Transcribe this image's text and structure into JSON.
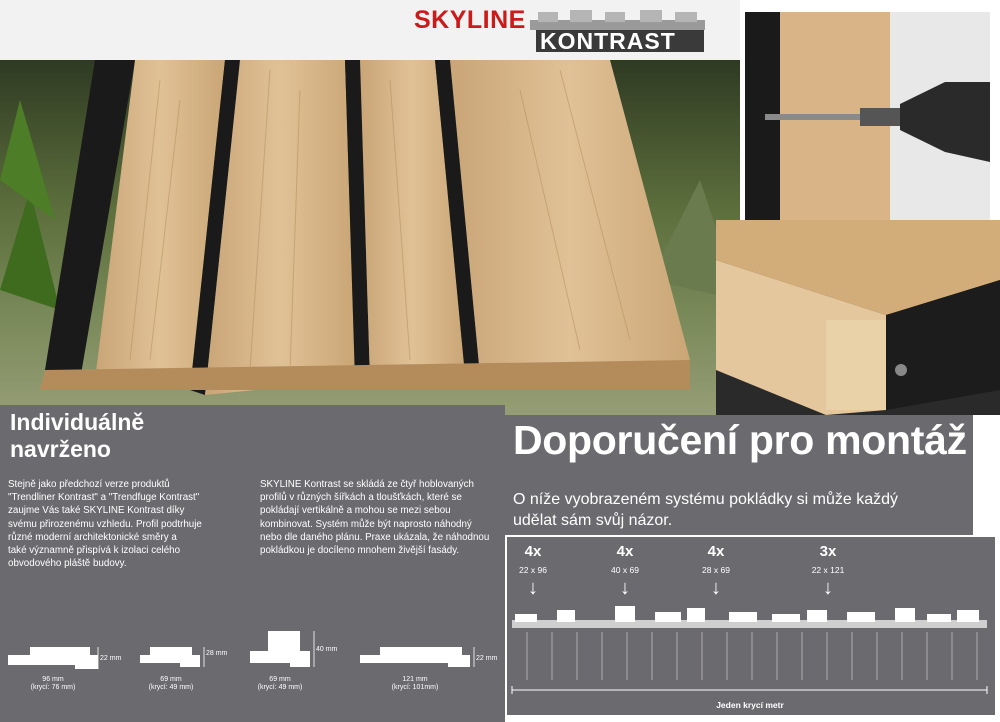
{
  "logo": {
    "brand": "SKYLINE",
    "product": "KONTRAST"
  },
  "left": {
    "title_line1": "Individuálně",
    "title_line2": "navrženo",
    "col1_lines": [
      "Stejně jako předchozí verze produktů",
      "\"Trendliner Kontrast\" a \"Trendfuge Kontrast\"",
      "zaujme Vás také SKYLINE Kontrast díky",
      "svému přirozenému vzhledu. Profil podtrhuje",
      "různé moderní architektonické směry a",
      "také významně přispívá k izolaci celého",
      "obvodového pláště budovy."
    ],
    "col2_lines": [
      "SKYLINE Kontrast se skládá ze čtyř hoblovaných",
      "profilů v různých šířkách a tloušťkách, které se",
      "pokládají vertikálně a mohou se mezi sebou",
      "kombinovat. Systém může být naprosto náhodný",
      "nebo dle daného plánu. Praxe ukázala, že náhodnou",
      "pokládkou je docíleno mnohem živější fasády."
    ],
    "profiles": [
      {
        "height": "22 mm",
        "width": "96 mm",
        "cover": "(krycí: 76 mm)"
      },
      {
        "height": "28 mm",
        "width": "69 mm",
        "cover": "(krycí: 49 mm)"
      },
      {
        "height": "40 mm",
        "width": "69 mm",
        "cover": "(krycí: 49 mm)"
      },
      {
        "height": "22 mm",
        "width": "121 mm",
        "cover": "(krycí: 101mm)"
      }
    ]
  },
  "right": {
    "title": "Doporučení pro montáž",
    "subtitle_line1": "O níže vyobrazeném systému pokládky si může každý",
    "subtitle_line2": "udělat sám svůj názor.",
    "items": [
      {
        "qty": "4x",
        "dims": "22 x 96"
      },
      {
        "qty": "4x",
        "dims": "40 x 69"
      },
      {
        "qty": "4x",
        "dims": "28 x 69"
      },
      {
        "qty": "3x",
        "dims": "22 x 121"
      }
    ],
    "cover_label": "Jeden krycí metr"
  },
  "colors": {
    "brand_red": "#cc1a1a",
    "panel_gray": "#6b6a6f",
    "wood": "#d9b98c"
  }
}
